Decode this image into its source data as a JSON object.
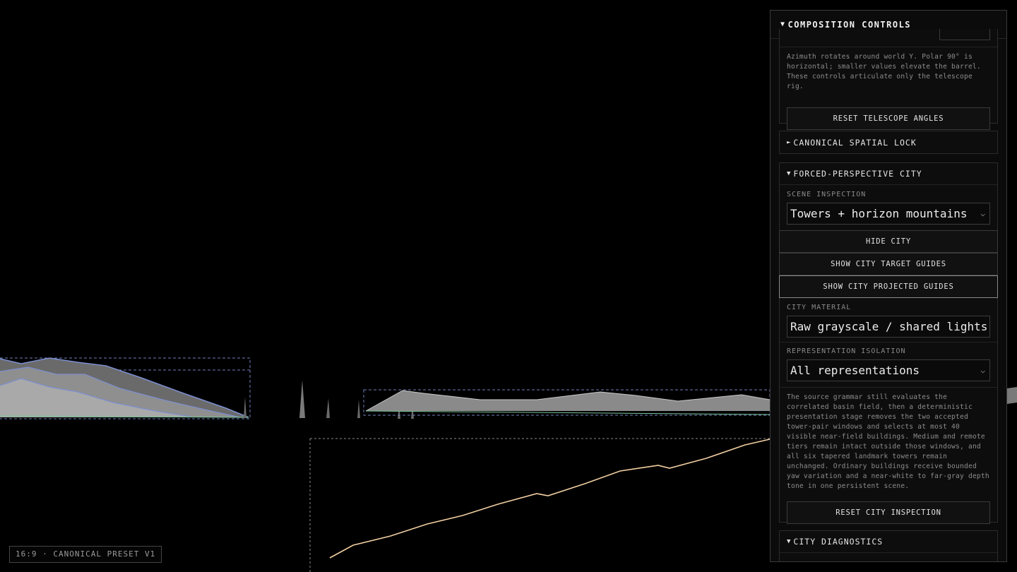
{
  "viewport": {
    "preset_badge": "16:9 · CANONICAL PRESET V1",
    "colors": {
      "mountain_fill": "#9a9a9a",
      "mountain_outline": "#7d8fd0",
      "ground_line": "#7fc49a",
      "guide_dash": "#6e80b8",
      "curve": "#f2cfa2"
    }
  },
  "panel": {
    "header_arrow": "▼",
    "title": "COMPOSITION CONTROLS",
    "telescope": {
      "help": "Azimuth rotates around world Y. Polar 90° is horizontal; smaller values elevate the barrel. These controls articulate only the telescope rig.",
      "reset_button": "RESET TELESCOPE ANGLES"
    },
    "spatial_lock": {
      "arrow": "►",
      "title": "CANONICAL SPATIAL LOCK"
    },
    "city": {
      "arrow": "▼",
      "title": "FORCED-PERSPECTIVE CITY",
      "scene_label": "SCENE INSPECTION",
      "scene_value": "Towers + horizon mountains",
      "hide_button": "HIDE CITY",
      "target_guides_button": "SHOW CITY TARGET GUIDES",
      "projected_guides_button": "SHOW CITY PROJECTED GUIDES",
      "material_label": "CITY MATERIAL",
      "material_value": "Raw grayscale / shared lights",
      "isolation_label": "REPRESENTATION ISOLATION",
      "isolation_value": "All representations",
      "help": "The source grammar still evaluates the correlated basin field, then a deterministic presentation stage removes the two accepted tower-pair windows and selects at most 40 visible near-field buildings. Medium and remote tiers remain intact outside those windows, and all six tapered landmark towers remain unchanged. Ordinary buildings receive bounded yaw variation and a near-white to far-gray depth tone in one persistent scene.",
      "reset_button": "RESET CITY INSPECTION"
    },
    "diagnostics": {
      "arrow": "▼",
      "title": "CITY DIAGNOSTICS"
    }
  }
}
